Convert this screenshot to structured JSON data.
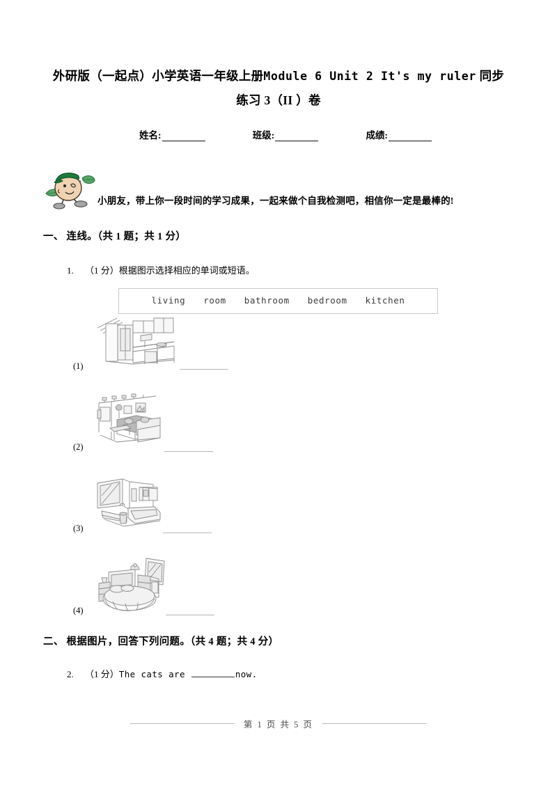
{
  "document": {
    "title_line1_prefix": "外研版（一起点）小学英语一年级上册",
    "title_line1_en": "Module 6 Unit 2 It's my ruler",
    "title_line1_suffix": "同步",
    "title_line2": "练习 3（II ）卷",
    "title_full": "外研版（一起点）小学英语一年级上册 Module 6 Unit 2 It's my ruler 同步练习 3（II ）卷"
  },
  "student_info": {
    "name_label": "姓名:",
    "class_label": "班级:",
    "score_label": "成绩:"
  },
  "banner": {
    "icon": "cartoon-boy-mascot-icon",
    "text": "小朋友，带上你一段时间的学习成果，一起来做个自我检测吧，相信你一定是最棒的!"
  },
  "sections": [
    {
      "id": "section-one",
      "heading": "一、 连线。（共 1 题；共 1 分）",
      "questions": [
        {
          "number": "1.",
          "prompt": "（1 分）根据图示选择相应的单词或短语。",
          "word_bank": [
            "living",
            "room",
            "bathroom",
            "bedroom",
            "kitchen"
          ],
          "items": [
            {
              "label": "(1)",
              "image": "kitchen-line-drawing-icon",
              "answer_blank": ""
            },
            {
              "label": "(2)",
              "image": "living-room-sofa-line-drawing-icon",
              "answer_blank": ""
            },
            {
              "label": "(3)",
              "image": "bathroom-bathtub-line-drawing-icon",
              "answer_blank": ""
            },
            {
              "label": "(4)",
              "image": "bedroom-bed-line-drawing-icon",
              "answer_blank": ""
            }
          ]
        }
      ]
    },
    {
      "id": "section-two",
      "heading": "二、 根据图片，回答下列问题。（共 4 题；共 4 分）",
      "questions": [
        {
          "number": "2.",
          "prompt_points": "（1 分）",
          "prompt_before_blank": "The cats are ",
          "prompt_after_blank": "now."
        }
      ]
    }
  ],
  "footer": {
    "text": "第 1 页 共 5 页"
  },
  "colors": {
    "text": "#000000",
    "rule": "#b5b5b5",
    "box_border": "#c8c8c8",
    "mascot_cap": "#1e7a3c",
    "mascot_skin": "#efd2b0",
    "mascot_leaf": "#3f9a56",
    "mascot_shoe": "#9a9a9a",
    "page_bg": "#ffffff"
  }
}
